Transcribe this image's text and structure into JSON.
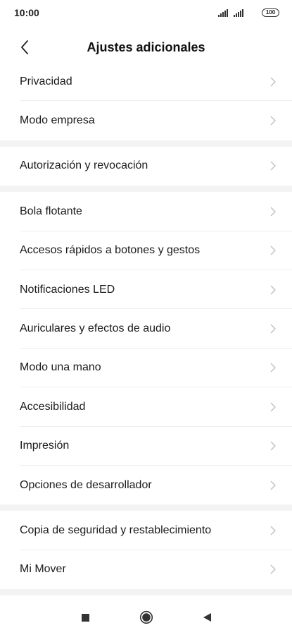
{
  "status_bar": {
    "time": "10:00",
    "battery": "100"
  },
  "header": {
    "title": "Ajustes adicionales"
  },
  "groups": [
    {
      "items": [
        {
          "label": "Privacidad"
        },
        {
          "label": "Modo empresa"
        }
      ]
    },
    {
      "items": [
        {
          "label": "Autorización y revocación"
        }
      ]
    },
    {
      "items": [
        {
          "label": "Bola flotante"
        },
        {
          "label": "Accesos rápidos a botones y gestos"
        },
        {
          "label": "Notificaciones LED"
        },
        {
          "label": "Auriculares y efectos de audio"
        },
        {
          "label": "Modo una mano"
        },
        {
          "label": "Accesibilidad"
        },
        {
          "label": "Impresión"
        },
        {
          "label": "Opciones de desarrollador"
        }
      ]
    },
    {
      "items": [
        {
          "label": "Copia de seguridad y restablecimiento"
        },
        {
          "label": "Mi Mover"
        }
      ]
    }
  ],
  "icons": {
    "back": "chevron-left-icon",
    "row_arrow": "chevron-right-icon",
    "nav_recents": "square-icon",
    "nav_home": "circle-icon",
    "nav_back": "triangle-left-icon"
  },
  "colors": {
    "background": "#ffffff",
    "group_separator": "#f3f3f3",
    "divider": "#eeeeee",
    "chevron": "#bdbdbd",
    "text": "#1b1b1b"
  }
}
